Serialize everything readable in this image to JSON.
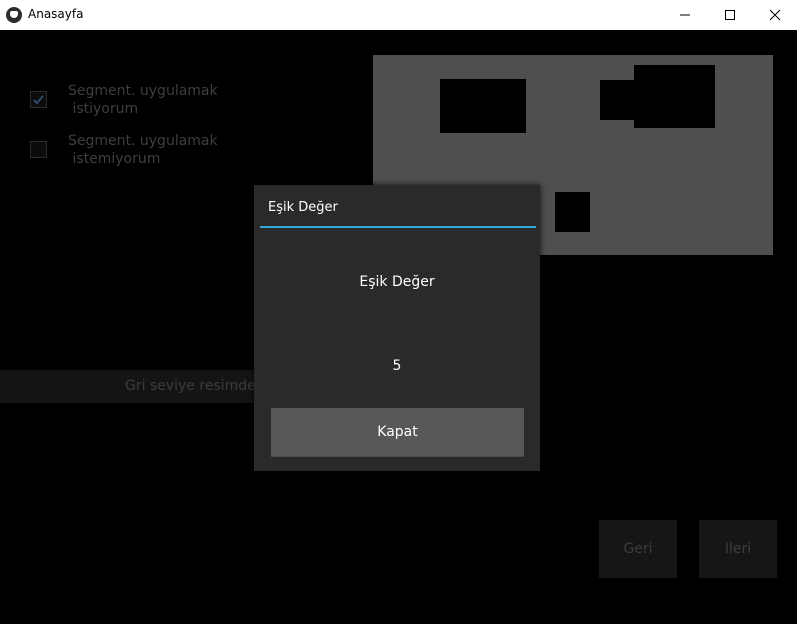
{
  "window": {
    "title": "Anasayfa",
    "app_icon": "kivy-app-icon",
    "controls": [
      "minimize-icon",
      "maximize-icon",
      "close-icon"
    ]
  },
  "options": [
    {
      "label": "Segment. uygulamak\n istiyorum",
      "checked": true
    },
    {
      "label": "Segment. uygulamak\n istemiyorum",
      "checked": false
    }
  ],
  "gray_bar": {
    "label": "Gri seviye resimde g"
  },
  "nav": {
    "back_label": "Geri",
    "next_label": "Ileri"
  },
  "popup": {
    "title": "Eşik Değer",
    "label": "Eşik Değer",
    "value": "5",
    "close_label": "Kapat",
    "accent_color": "#33a8d8"
  },
  "colors": {
    "background": "#000000",
    "preview_bg": "#4f4f4f",
    "popup_bg": "#2a2a2a",
    "button_bg": "#585858"
  }
}
